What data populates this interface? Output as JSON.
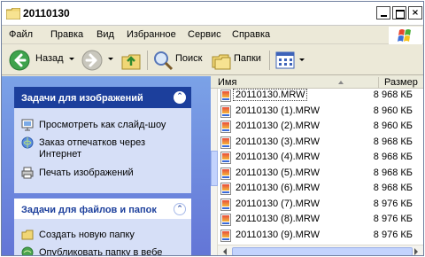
{
  "window": {
    "title": "20110130",
    "controls": {
      "minimize": "_",
      "maximize": "□",
      "close": "×"
    }
  },
  "menu": {
    "items": [
      "Файл",
      "Правка",
      "Вид",
      "Избранное",
      "Сервис",
      "Справка"
    ]
  },
  "toolbar": {
    "back_label": "Назад",
    "search_label": "Поиск",
    "folders_label": "Папки"
  },
  "left_pane": {
    "image_tasks": {
      "header": "Задачи для изображений",
      "items": [
        {
          "label": "Просмотреть как слайд-шоу",
          "icon": "slideshow-icon"
        },
        {
          "label": "Заказ отпечатков через",
          "label2": "Интернет",
          "icon": "order-prints-icon"
        },
        {
          "label": "Печать изображений",
          "icon": "print-icon"
        }
      ]
    },
    "file_tasks": {
      "header": "Задачи для файлов и папок",
      "items": [
        {
          "label": "Создать новую папку",
          "icon": "new-folder-icon"
        },
        {
          "label": "Опубликовать папку в вебе",
          "icon": "publish-web-icon"
        }
      ]
    }
  },
  "file_list": {
    "columns": {
      "name": "Имя",
      "size": "Размер"
    },
    "rows": [
      {
        "name": "20110130.MRW",
        "size": "8 968 КБ",
        "selected": true
      },
      {
        "name": "20110130 (1).MRW",
        "size": "8 960 КБ"
      },
      {
        "name": "20110130 (2).MRW",
        "size": "8 960 КБ"
      },
      {
        "name": "20110130 (3).MRW",
        "size": "8 968 КБ"
      },
      {
        "name": "20110130 (4).MRW",
        "size": "8 968 КБ"
      },
      {
        "name": "20110130 (5).MRW",
        "size": "8 968 КБ"
      },
      {
        "name": "20110130 (6).MRW",
        "size": "8 968 КБ"
      },
      {
        "name": "20110130 (7).MRW",
        "size": "8 976 КБ"
      },
      {
        "name": "20110130 (8).MRW",
        "size": "8 976 КБ"
      },
      {
        "name": "20110130 (9).MRW",
        "size": "8 976 КБ"
      }
    ]
  },
  "colors": {
    "titlebar": "#ffffff",
    "task_header_dark": "#1c3f9c",
    "task_pane_bg": "#d6dff7",
    "left_gradient_top": "#7ba2e7",
    "left_gradient_bottom": "#6375d6"
  }
}
